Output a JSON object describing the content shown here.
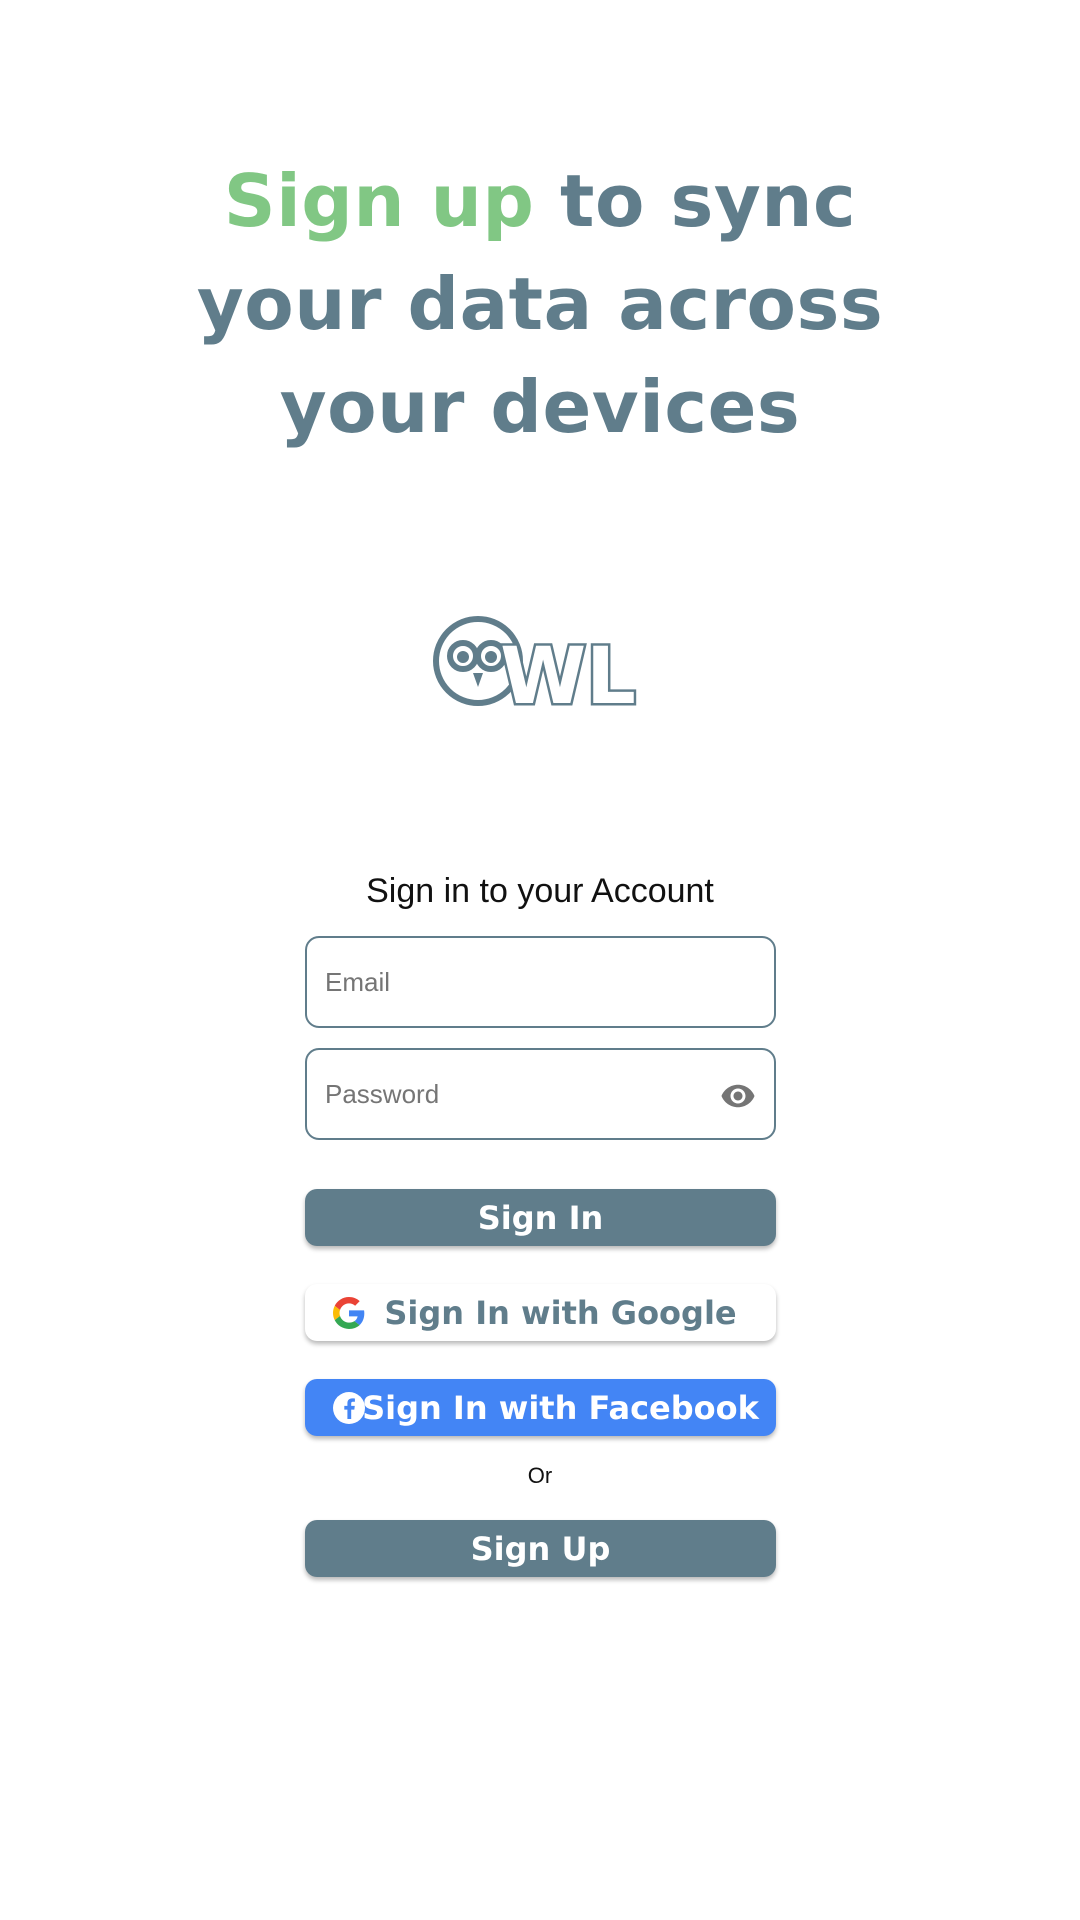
{
  "headline": {
    "accent": "Sign up",
    "line1_rest": " to sync",
    "line2": "your data across",
    "line3": "your devices"
  },
  "logo": {
    "text": "WL"
  },
  "form": {
    "title": "Sign in to your Account",
    "email_placeholder": "Email",
    "password_placeholder": "Password"
  },
  "buttons": {
    "sign_in": "Sign In",
    "google": "Sign In with Google",
    "facebook": "Sign In with Facebook",
    "or": "Or",
    "sign_up": "Sign Up"
  },
  "colors": {
    "primary": "#607d8b",
    "accent": "#81c784",
    "facebook": "#4385f5",
    "background": "#ffffff"
  },
  "icons": {
    "password_toggle": "eye-icon",
    "google": "google-g-icon",
    "facebook": "facebook-f-icon",
    "logo": "owl-logo"
  }
}
